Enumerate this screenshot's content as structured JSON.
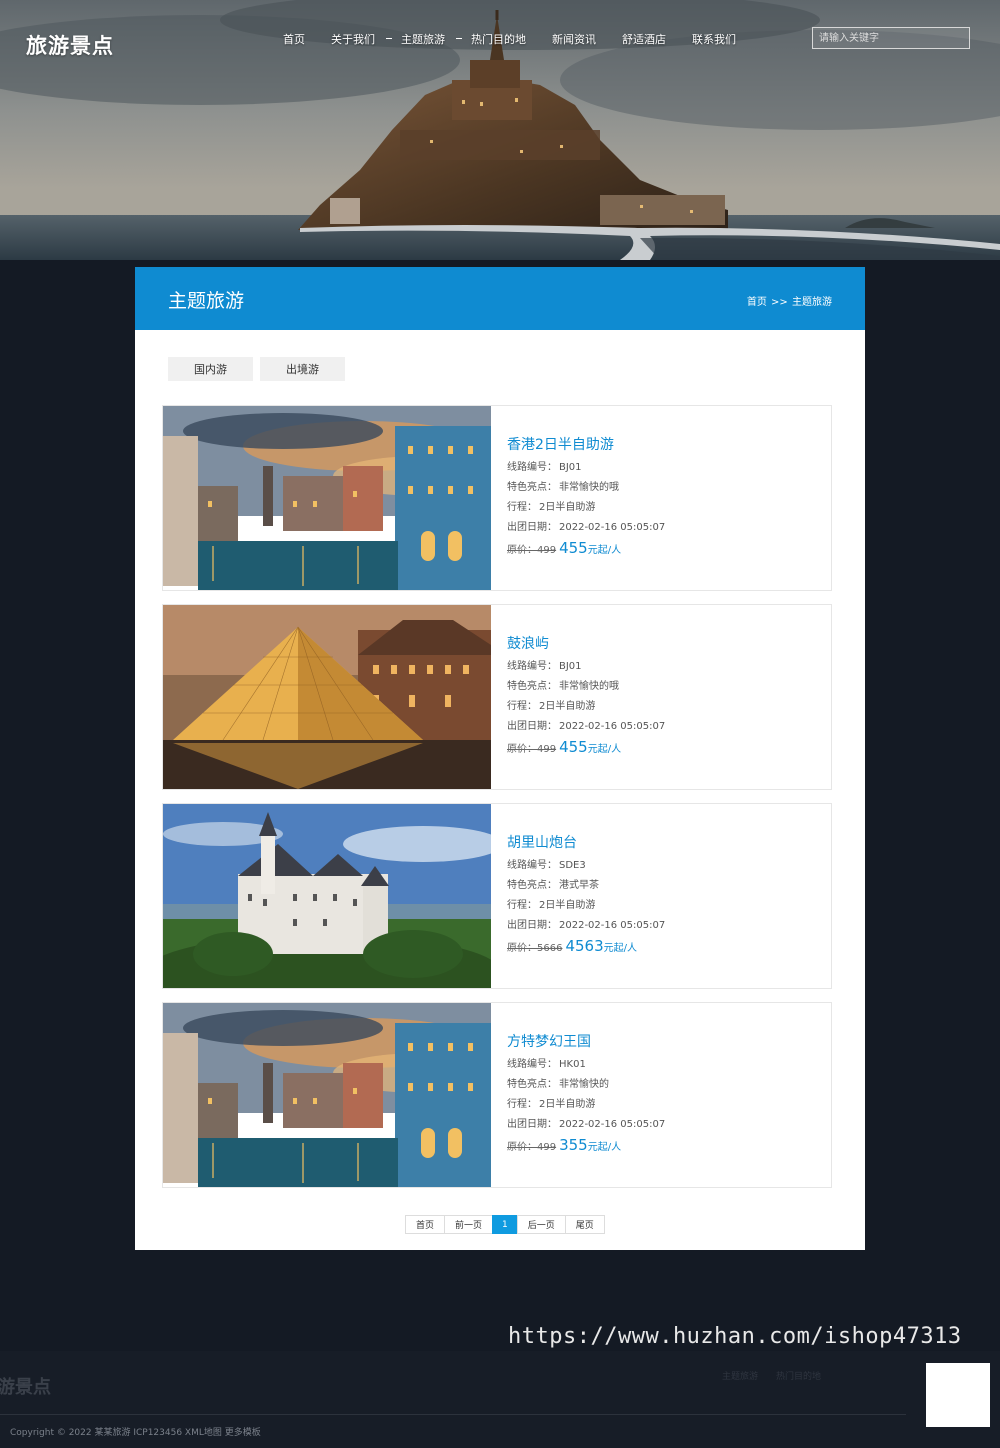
{
  "header": {
    "logo": "旅游景点",
    "nav": [
      "首页",
      "关于我们",
      "主题旅游",
      "热门目的地",
      "新闻资讯",
      "舒适酒店",
      "联系我们"
    ],
    "search_placeholder": "请输入关键字"
  },
  "panel": {
    "title": "主题旅游",
    "breadcrumb": {
      "home": "首页",
      "sep": ">>",
      "current": "主题旅游"
    },
    "tabs": [
      "国内游",
      "出境游"
    ]
  },
  "tours": [
    {
      "name": "香港2日半自助游",
      "code_label": "线路编号：",
      "code": "BJ01",
      "feature_label": "特色亮点：",
      "feature": "非常愉快的哦",
      "trip_label": "行程：",
      "trip": "2日半自助游",
      "date_label": "出团日期：",
      "date": "2022-02-16 05:05:07",
      "old_price": "原价：499",
      "price": "455",
      "unit": "元起/人",
      "image": "venice"
    },
    {
      "name": "鼓浪屿",
      "code_label": "线路编号：",
      "code": "BJ01",
      "feature_label": "特色亮点：",
      "feature": "非常愉快的哦",
      "trip_label": "行程：",
      "trip": "2日半自助游",
      "date_label": "出团日期：",
      "date": "2022-02-16 05:05:07",
      "old_price": "原价：499",
      "price": "455",
      "unit": "元起/人",
      "image": "louvre"
    },
    {
      "name": "胡里山炮台",
      "code_label": "线路编号：",
      "code": "SDE3",
      "feature_label": "特色亮点：",
      "feature": "港式早茶",
      "trip_label": "行程：",
      "trip": "2日半自助游",
      "date_label": "出团日期：",
      "date": "2022-02-16 05:05:07",
      "old_price": "原价：5666",
      "price": "4563",
      "unit": "元起/人",
      "image": "castle"
    },
    {
      "name": "方特梦幻王国",
      "code_label": "线路编号：",
      "code": "HK01",
      "feature_label": "特色亮点：",
      "feature": "非常愉快的",
      "trip_label": "行程：",
      "trip": "2日半自助游",
      "date_label": "出团日期：",
      "date": "2022-02-16 05:05:07",
      "old_price": "原价：499",
      "price": "355",
      "unit": "元起/人",
      "image": "venice"
    }
  ],
  "pagination": [
    "首页",
    "前一页",
    "1",
    "后一页",
    "尾页"
  ],
  "watermark": "https://www.huzhan.com/ishop47313",
  "footer": {
    "logo": "游景点",
    "links": [
      "主题旅游",
      "热门目的地"
    ],
    "copyright": "Copyright © 2022 某某旅游 ICP123456 XML地图 更多模板"
  },
  "colors": {
    "accent": "#0f8bd1",
    "background": "#141a24",
    "pager_active": "#0f9be0"
  }
}
